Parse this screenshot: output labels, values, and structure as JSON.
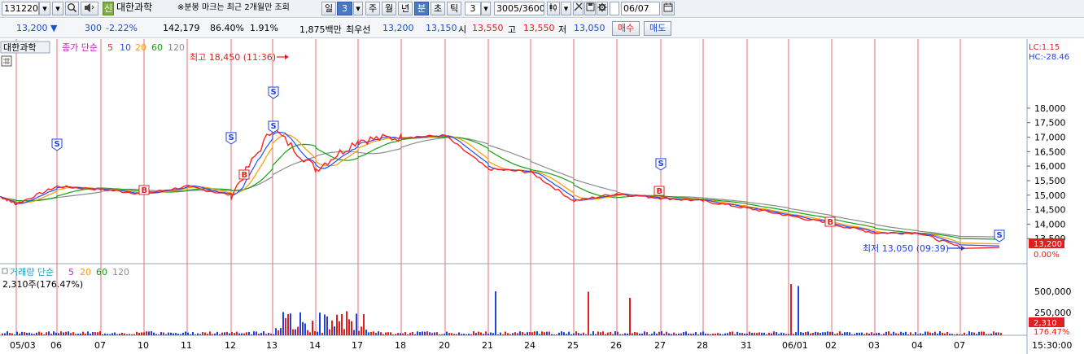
{
  "toolbar": {
    "code": "131220",
    "stock_name": "대한과학",
    "stock_badge": "신",
    "notice": "※분봉 마크는 최근 2개월만 조회",
    "period_day": "일",
    "period_num": "3",
    "period_week": "주",
    "period_month": "월",
    "period_year": "년",
    "period_min": "분",
    "period_sec": "초",
    "period_tick": "틱",
    "interval": "3",
    "count": "3005/3600",
    "date": "06/07"
  },
  "info": {
    "price": "13,200",
    "change_arrow": "▼",
    "change": "300",
    "change_pct": "-2.22%",
    "volume": "142,179",
    "vol_ratio": "86.40%",
    "turnover": "1.91%",
    "amount": "1,875백만",
    "best_label": "최우선",
    "best_ask": "13,200",
    "best_bid": "13,150",
    "open_label": "시",
    "open": "13,550",
    "high_label": "고",
    "high": "13,550",
    "low_label": "저",
    "low": "13,050",
    "buy": "매수",
    "sell": "매도"
  },
  "chart": {
    "stock_tag": "대한과학",
    "legend_title": "종가 단순",
    "ma_labels": [
      "5",
      "10",
      "20",
      "60",
      "120"
    ],
    "lc_label": "LC:1.15",
    "hc_label": "HC:-28.46",
    "high_marker": "최고 18,450 (11:36)",
    "low_marker": "최저 13,050 (09:39)",
    "price_ticks": [
      "18,000",
      "17,500",
      "17,000",
      "16,500",
      "16,000",
      "15,500",
      "15,000",
      "14,500",
      "14,000",
      "13,500"
    ],
    "current_price_box": "13,200",
    "current_pct": "0.00%",
    "volume_title": "거래량 단순",
    "volume_ma": [
      "5",
      "20",
      "60",
      "120"
    ],
    "volume_current": "2,310주(176.47%)",
    "volume_ticks": [
      "500,000",
      "250,000"
    ],
    "volume_box": "2,310",
    "volume_pct": "176.47%",
    "date_labels": [
      "05/03",
      "06",
      "07",
      "10",
      "11",
      "12",
      "13",
      "14",
      "17",
      "18",
      "20",
      "21",
      "24",
      "25",
      "26",
      "27",
      "28",
      "31",
      "06/01",
      "02",
      "03",
      "04",
      "07"
    ],
    "time_label": "15:30:00",
    "colors": {
      "ma5": "#ff2020",
      "ma10": "#2050ff",
      "ma20": "#ff9a00",
      "ma60": "#14a014",
      "ma120": "#8c8c8c",
      "up": "#e02020",
      "down": "#2040e0"
    }
  },
  "chart_data": {
    "type": "line",
    "title": "대한과학",
    "ylim": [
      13000,
      18700
    ],
    "x": [
      "05/03",
      "06",
      "07",
      "10",
      "11",
      "12",
      "13",
      "14",
      "17",
      "18",
      "20",
      "21",
      "24",
      "25",
      "26",
      "27",
      "28",
      "31",
      "06/01",
      "02",
      "03",
      "04",
      "07"
    ],
    "series": [
      {
        "name": "종가",
        "values": [
          14700,
          15300,
          15200,
          15050,
          15300,
          15000,
          17300,
          15900,
          16900,
          17000,
          17050,
          15900,
          15800,
          14800,
          15050,
          14900,
          14800,
          14550,
          14300,
          14000,
          13700,
          13700,
          13200
        ]
      }
    ],
    "markers": [
      {
        "type": "S",
        "date": "06"
      },
      {
        "type": "B",
        "date": "10"
      },
      {
        "type": "S",
        "date": "12"
      },
      {
        "type": "B",
        "date": "12"
      },
      {
        "type": "S",
        "date": "13"
      },
      {
        "type": "S",
        "date": "13"
      },
      {
        "type": "S",
        "date": "27"
      },
      {
        "type": "B",
        "date": "27"
      },
      {
        "type": "B",
        "date": "03"
      },
      {
        "type": "S",
        "date": "07"
      }
    ],
    "high": 18450,
    "low": 13050
  }
}
